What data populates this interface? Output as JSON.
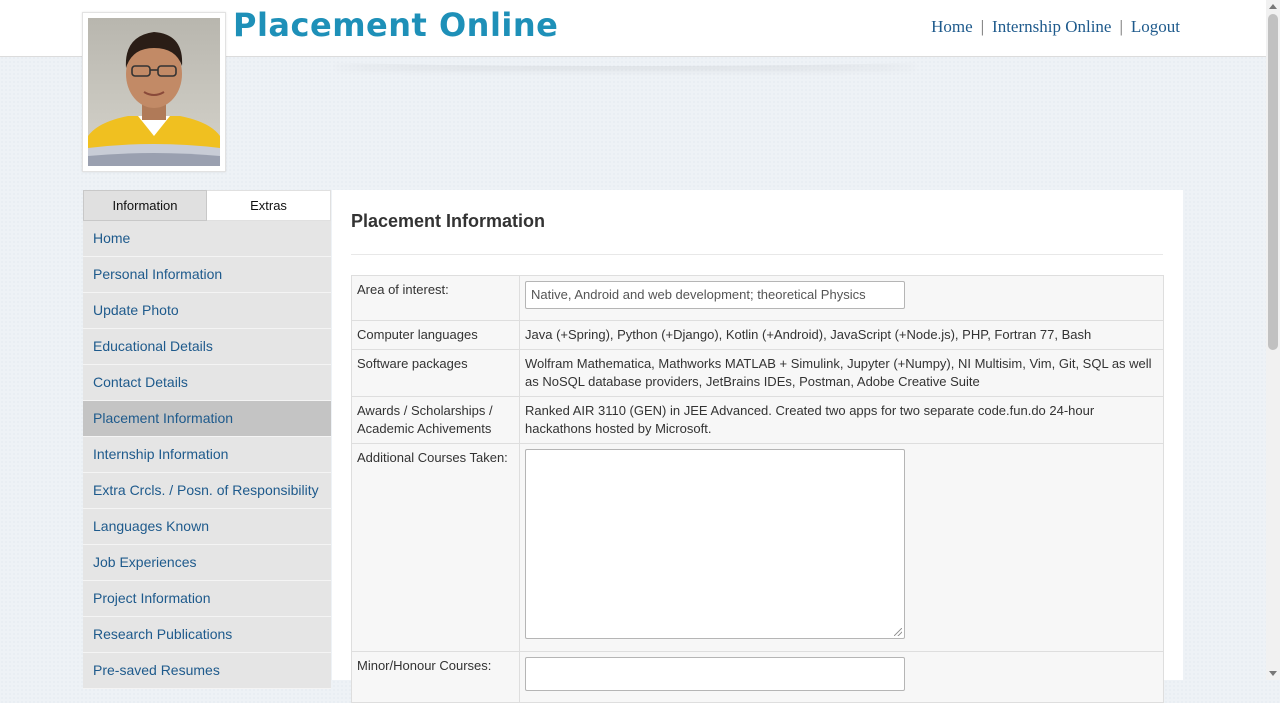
{
  "header": {
    "site_title": "Placement Online",
    "nav": [
      "Home",
      "Internship Online",
      "Logout"
    ],
    "nav_separator": "|"
  },
  "sidebar": {
    "tabs": [
      "Information",
      "Extras"
    ],
    "items": [
      "Home",
      "Personal Information",
      "Update Photo",
      "Educational Details",
      "Contact Details",
      "Placement Information",
      "Internship Information",
      "Extra Crcls. / Posn. of Responsibility",
      "Languages Known",
      "Job Experiences",
      "Project Information",
      "Research Publications",
      "Pre-saved Resumes"
    ],
    "selected_item": "Placement Information"
  },
  "main": {
    "title": "Placement Information",
    "rows": {
      "area_of_interest": {
        "label": "Area of interest:",
        "value": "Native, Android and web development; theoretical Physics"
      },
      "computer_languages": {
        "label": "Computer languages",
        "value": "Java (+Spring), Python (+Django), Kotlin (+Android), JavaScript (+Node.js), PHP, Fortran 77, Bash"
      },
      "software_packages": {
        "label": "Software packages",
        "value": "Wolfram Mathematica, Mathworks MATLAB + Simulink, Jupyter (+Numpy), NI Multisim, Vim, Git, SQL as well as NoSQL database providers, JetBrains IDEs, Postman, Adobe Creative Suite"
      },
      "awards": {
        "label": "Awards / Scholarships / Academic Achivements",
        "value": "Ranked AIR 3110 (GEN) in JEE Advanced. Created two apps for two separate code.fun.do 24-hour hackathons hosted by Microsoft."
      },
      "additional_courses": {
        "label": "Additional Courses Taken:",
        "value": ""
      },
      "minor_honour": {
        "label": "Minor/Honour Courses:",
        "value": ""
      }
    }
  },
  "colors": {
    "title_accent": "#1e90b8",
    "link": "#1e5a8c",
    "sidebar_bg": "#e5e5e5",
    "sidebar_selected": "#c4c4c4"
  }
}
